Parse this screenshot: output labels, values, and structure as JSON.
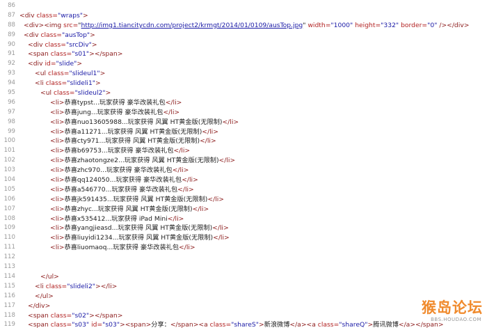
{
  "lines": [
    {
      "n": "86",
      "indent": 0,
      "tokens": []
    },
    {
      "n": "87",
      "indent": 0,
      "tokens": [
        {
          "t": "tag",
          "v": "<div "
        },
        {
          "t": "attr",
          "v": "class="
        },
        {
          "t": "val",
          "v": "\"wraps\""
        },
        {
          "t": "tag",
          "v": ">"
        }
      ]
    },
    {
      "n": "88",
      "indent": 1,
      "tokens": [
        {
          "t": "tag",
          "v": "<div><img "
        },
        {
          "t": "attr",
          "v": "src="
        },
        {
          "t": "txt",
          "v": "\""
        },
        {
          "t": "url",
          "v": "http://img1.tiancitycdn.com/project2/krmgt/2014/01/0109/ausTop.jpg"
        },
        {
          "t": "txt",
          "v": "\" "
        },
        {
          "t": "attr",
          "v": "width="
        },
        {
          "t": "val",
          "v": "\"1000\" "
        },
        {
          "t": "attr",
          "v": "height="
        },
        {
          "t": "val",
          "v": "\"332\" "
        },
        {
          "t": "attr",
          "v": "border="
        },
        {
          "t": "val",
          "v": "\"0\" "
        },
        {
          "t": "tag",
          "v": "/></div>"
        }
      ]
    },
    {
      "n": "89",
      "indent": 1,
      "tokens": [
        {
          "t": "tag",
          "v": "<div "
        },
        {
          "t": "attr",
          "v": "class="
        },
        {
          "t": "val",
          "v": "\"ausTop\""
        },
        {
          "t": "tag",
          "v": ">"
        }
      ]
    },
    {
      "n": "90",
      "indent": 2,
      "tokens": [
        {
          "t": "tag",
          "v": "<div "
        },
        {
          "t": "attr",
          "v": "class="
        },
        {
          "t": "val",
          "v": "\"srcDiv\""
        },
        {
          "t": "tag",
          "v": ">"
        }
      ]
    },
    {
      "n": "91",
      "indent": 2,
      "tokens": [
        {
          "t": "tag",
          "v": "<span "
        },
        {
          "t": "attr",
          "v": "class="
        },
        {
          "t": "val",
          "v": "\"s01\""
        },
        {
          "t": "tag",
          "v": "></span>"
        }
      ]
    },
    {
      "n": "92",
      "indent": 2,
      "tokens": [
        {
          "t": "tag",
          "v": "<div "
        },
        {
          "t": "attr",
          "v": "id="
        },
        {
          "t": "val",
          "v": "\"slide\""
        },
        {
          "t": "tag",
          "v": ">"
        }
      ]
    },
    {
      "n": "93",
      "indent": 3,
      "tokens": [
        {
          "t": "tag",
          "v": "<ul "
        },
        {
          "t": "attr",
          "v": "class="
        },
        {
          "t": "val",
          "v": "\"slideul1\""
        },
        {
          "t": "tag",
          "v": ">"
        }
      ]
    },
    {
      "n": "94",
      "indent": 3,
      "tokens": [
        {
          "t": "tag",
          "v": "<li "
        },
        {
          "t": "attr",
          "v": "class="
        },
        {
          "t": "val",
          "v": "\"slideli1\""
        },
        {
          "t": "tag",
          "v": ">"
        }
      ]
    },
    {
      "n": "95",
      "indent": 4,
      "tokens": [
        {
          "t": "tag",
          "v": "<ul "
        },
        {
          "t": "attr",
          "v": "class="
        },
        {
          "t": "val",
          "v": "\"slideul2\""
        },
        {
          "t": "tag",
          "v": ">"
        }
      ]
    },
    {
      "n": "96",
      "indent": 5,
      "tokens": [
        {
          "t": "tag",
          "v": "<li>"
        },
        {
          "t": "txt",
          "v": "恭喜typst...玩家获得 豪华改装礼包"
        },
        {
          "t": "tag",
          "v": "</li>"
        }
      ]
    },
    {
      "n": "97",
      "indent": 5,
      "tokens": [
        {
          "t": "tag",
          "v": "<li>"
        },
        {
          "t": "txt",
          "v": "恭喜jung...玩家获得 豪华改装礼包"
        },
        {
          "t": "tag",
          "v": "</li>"
        }
      ]
    },
    {
      "n": "98",
      "indent": 5,
      "tokens": [
        {
          "t": "tag",
          "v": "<li>"
        },
        {
          "t": "txt",
          "v": "恭喜nuo13605988...玩家获得 风翼 HT黄金版(无限制)"
        },
        {
          "t": "tag",
          "v": "</li>"
        }
      ]
    },
    {
      "n": "99",
      "indent": 5,
      "tokens": [
        {
          "t": "tag",
          "v": "<li>"
        },
        {
          "t": "txt",
          "v": "恭喜a11271...玩家获得 风翼 HT黄金版(无限制)"
        },
        {
          "t": "tag",
          "v": "</li>"
        }
      ]
    },
    {
      "n": "100",
      "indent": 5,
      "tokens": [
        {
          "t": "tag",
          "v": "<li>"
        },
        {
          "t": "txt",
          "v": "恭喜cty971...玩家获得 风翼 HT黄金版(无限制)"
        },
        {
          "t": "tag",
          "v": "</li>"
        }
      ]
    },
    {
      "n": "101",
      "indent": 5,
      "tokens": [
        {
          "t": "tag",
          "v": "<li>"
        },
        {
          "t": "txt",
          "v": "恭喜b69753...玩家获得 豪华改装礼包"
        },
        {
          "t": "tag",
          "v": "</li>"
        }
      ]
    },
    {
      "n": "102",
      "indent": 5,
      "tokens": [
        {
          "t": "tag",
          "v": "<li>"
        },
        {
          "t": "txt",
          "v": "恭喜zhaotongze2...玩家获得 风翼 HT黄金版(无限制)"
        },
        {
          "t": "tag",
          "v": "</li>"
        }
      ]
    },
    {
      "n": "103",
      "indent": 5,
      "tokens": [
        {
          "t": "tag",
          "v": "<li>"
        },
        {
          "t": "txt",
          "v": "恭喜zhc970...玩家获得 豪华改装礼包"
        },
        {
          "t": "tag",
          "v": "</li>"
        }
      ]
    },
    {
      "n": "104",
      "indent": 5,
      "tokens": [
        {
          "t": "tag",
          "v": "<li>"
        },
        {
          "t": "txt",
          "v": "恭喜qq124050...玩家获得 豪华改装礼包"
        },
        {
          "t": "tag",
          "v": "</li>"
        }
      ]
    },
    {
      "n": "105",
      "indent": 5,
      "tokens": [
        {
          "t": "tag",
          "v": "<li>"
        },
        {
          "t": "txt",
          "v": "恭喜a546770...玩家获得 豪华改装礼包"
        },
        {
          "t": "tag",
          "v": "</li>"
        }
      ]
    },
    {
      "n": "106",
      "indent": 5,
      "tokens": [
        {
          "t": "tag",
          "v": "<li>"
        },
        {
          "t": "txt",
          "v": "恭喜jk591435...玩家获得 风翼 HT黄金版(无限制)"
        },
        {
          "t": "tag",
          "v": "</li>"
        }
      ]
    },
    {
      "n": "107",
      "indent": 5,
      "tokens": [
        {
          "t": "tag",
          "v": "<li>"
        },
        {
          "t": "txt",
          "v": "恭喜zhyc...玩家获得 风翼 HT黄金版(无限制)"
        },
        {
          "t": "tag",
          "v": "</li>"
        }
      ]
    },
    {
      "n": "108",
      "indent": 5,
      "tokens": [
        {
          "t": "tag",
          "v": "<li>"
        },
        {
          "t": "txt",
          "v": "恭喜x535412...玩家获得 iPad Mini"
        },
        {
          "t": "tag",
          "v": "</li>"
        }
      ]
    },
    {
      "n": "109",
      "indent": 5,
      "tokens": [
        {
          "t": "tag",
          "v": "<li>"
        },
        {
          "t": "txt",
          "v": "恭喜yangjieasd...玩家获得 风翼 HT黄金版(无限制)"
        },
        {
          "t": "tag",
          "v": "</li>"
        }
      ]
    },
    {
      "n": "110",
      "indent": 5,
      "tokens": [
        {
          "t": "tag",
          "v": "<li>"
        },
        {
          "t": "txt",
          "v": "恭喜liuyidi1234...玩家获得 风翼 HT黄金版(无限制)"
        },
        {
          "t": "tag",
          "v": "</li>"
        }
      ]
    },
    {
      "n": "111",
      "indent": 5,
      "tokens": [
        {
          "t": "tag",
          "v": "<li>"
        },
        {
          "t": "txt",
          "v": "恭喜liuomaoq...玩家获得 豪华改装礼包"
        },
        {
          "t": "tag",
          "v": "</li>"
        }
      ]
    },
    {
      "n": "112",
      "indent": 0,
      "tokens": []
    },
    {
      "n": "113",
      "indent": 0,
      "tokens": []
    },
    {
      "n": "114",
      "indent": 4,
      "tokens": [
        {
          "t": "tag",
          "v": "</ul>"
        }
      ]
    },
    {
      "n": "115",
      "indent": 3,
      "tokens": [
        {
          "t": "tag",
          "v": "<li "
        },
        {
          "t": "attr",
          "v": "class="
        },
        {
          "t": "val",
          "v": "\"slideli2\""
        },
        {
          "t": "tag",
          "v": "></li>"
        }
      ]
    },
    {
      "n": "116",
      "indent": 3,
      "tokens": [
        {
          "t": "tag",
          "v": "</ul>"
        }
      ]
    },
    {
      "n": "117",
      "indent": 2,
      "tokens": [
        {
          "t": "tag",
          "v": "</div>"
        }
      ]
    },
    {
      "n": "118",
      "indent": 2,
      "tokens": [
        {
          "t": "tag",
          "v": "<span "
        },
        {
          "t": "attr",
          "v": "class="
        },
        {
          "t": "val",
          "v": "\"s02\""
        },
        {
          "t": "tag",
          "v": "></span>"
        }
      ]
    },
    {
      "n": "119",
      "indent": 2,
      "tokens": [
        {
          "t": "tag",
          "v": "<span "
        },
        {
          "t": "attr",
          "v": "class="
        },
        {
          "t": "val",
          "v": "\"s03\" "
        },
        {
          "t": "attr",
          "v": "id="
        },
        {
          "t": "val",
          "v": "\"s03\""
        },
        {
          "t": "tag",
          "v": "><span>"
        },
        {
          "t": "txt",
          "v": "分享："
        },
        {
          "t": "tag",
          "v": "</span><a "
        },
        {
          "t": "attr",
          "v": "class="
        },
        {
          "t": "val",
          "v": "\"shareS\""
        },
        {
          "t": "tag",
          "v": ">"
        },
        {
          "t": "txt",
          "v": "新浪微博"
        },
        {
          "t": "tag",
          "v": "</a><a "
        },
        {
          "t": "attr",
          "v": "class="
        },
        {
          "t": "val",
          "v": "\"shareQ\""
        },
        {
          "t": "tag",
          "v": ">"
        },
        {
          "t": "txt",
          "v": "腾讯微博"
        },
        {
          "t": "tag",
          "v": "</a></span>"
        }
      ]
    }
  ],
  "watermark": {
    "logo": "猴岛论坛",
    "url": "BBS.HOUDAO.COM"
  },
  "colors": {
    "tag": "#8b1a1a",
    "attr": "#b22222",
    "value": "#1a1aa6",
    "text": "#222222",
    "line_number": "#9a9a9a",
    "watermark": "#f08a2c"
  }
}
